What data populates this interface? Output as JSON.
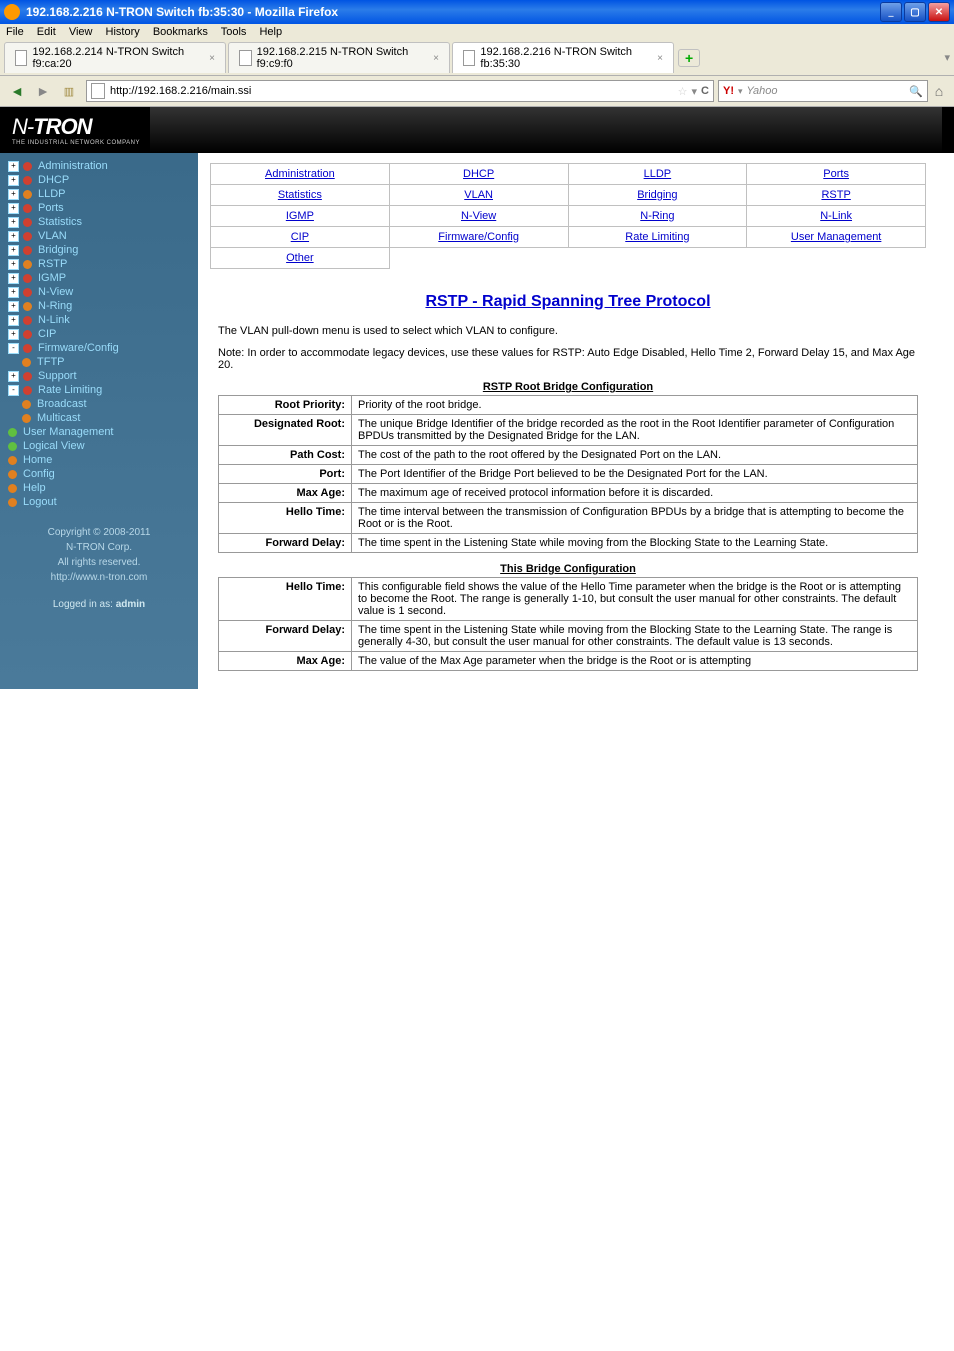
{
  "window": {
    "title": "192.168.2.216 N-TRON Switch fb:35:30 - Mozilla Firefox"
  },
  "menu": {
    "file": "File",
    "edit": "Edit",
    "view": "View",
    "history": "History",
    "bookmarks": "Bookmarks",
    "tools": "Tools",
    "help": "Help"
  },
  "tabs": [
    {
      "label": "192.168.2.214 N-TRON Switch f9:ca:20"
    },
    {
      "label": "192.168.2.215 N-TRON Switch f9:c9:f0"
    },
    {
      "label": "192.168.2.216 N-TRON Switch fb:35:30"
    }
  ],
  "url": "http://192.168.2.216/main.ssi",
  "search_placeholder": "Yahoo",
  "logo": {
    "brand": "N-TRON",
    "sub": "THE INDUSTRIAL NETWORK COMPANY"
  },
  "tree": {
    "admin": "Administration",
    "dhcp": "DHCP",
    "lldp": "LLDP",
    "ports": "Ports",
    "stats": "Statistics",
    "vlan": "VLAN",
    "bridging": "Bridging",
    "rstp": "RSTP",
    "igmp": "IGMP",
    "nview": "N-View",
    "nring": "N-Ring",
    "nlink": "N-Link",
    "cip": "CIP",
    "fw": "Firmware/Config",
    "tftp": "TFTP",
    "support": "Support",
    "rate": "Rate Limiting",
    "broadcast": "Broadcast",
    "multicast": "Multicast",
    "usermgmt": "User Management",
    "logical": "Logical View",
    "home": "Home",
    "config": "Config",
    "help": "Help",
    "logout": "Logout"
  },
  "footer": {
    "copyright": "Copyright © 2008-2011",
    "corp": "N-TRON Corp.",
    "rights": "All rights reserved.",
    "url": "http://www.n-tron.com",
    "logged_label": "Logged in as:",
    "user": "admin"
  },
  "links": {
    "administration": "Administration",
    "dhcp": "DHCP",
    "lldp": "LLDP",
    "ports": "Ports",
    "statistics": "Statistics",
    "vlan": "VLAN",
    "bridging": "Bridging",
    "rstp": "RSTP",
    "igmp": "IGMP",
    "nview": "N-View",
    "nring": "N-Ring",
    "nlink": "N-Link",
    "cip": "CIP",
    "fw": "Firmware/Config",
    "rate": "Rate Limiting",
    "usermgmt": "User Management",
    "other": "Other"
  },
  "page": {
    "title": "RSTP - Rapid Spanning Tree Protocol",
    "intro1": "The VLAN pull-down menu is used to select which VLAN to configure.",
    "intro2": "Note: In order to accommodate legacy devices, use these values for RSTP: Auto Edge Disabled, Hello Time 2, Forward Delay 15, and Max Age 20.",
    "root_title": "RSTP Root Bridge Configuration",
    "root": [
      {
        "k": "Root Priority:",
        "v": "Priority of the root bridge."
      },
      {
        "k": "Designated Root:",
        "v": "The unique Bridge Identifier of the bridge recorded as the root in the Root Identifier parameter of Configuration BPDUs transmitted by the Designated Bridge for the LAN."
      },
      {
        "k": "Path Cost:",
        "v": "The cost of the path to the root offered by the Designated Port on the LAN."
      },
      {
        "k": "Port:",
        "v": "The Port Identifier of the Bridge Port believed to be the Designated Port for the LAN."
      },
      {
        "k": "Max Age:",
        "v": "The maximum age of received protocol information before it is discarded."
      },
      {
        "k": "Hello Time:",
        "v": "The time interval between the transmission of Configuration BPDUs by a bridge that is attempting to become the Root or is the Root."
      },
      {
        "k": "Forward Delay:",
        "v": "The time spent in the Listening State while moving from the Blocking State to the Learning State."
      }
    ],
    "this_title": "This Bridge Configuration",
    "this": [
      {
        "k": "Hello Time:",
        "v": "This configurable field shows the value of the Hello Time parameter when the bridge is the Root or is attempting to become the Root. The range is generally 1-10, but consult the user manual for other constraints. The default value is 1 second."
      },
      {
        "k": "Forward Delay:",
        "v": "The time spent in the Listening State while moving from the Blocking State to the Learning State. The range is generally 4-30, but consult the user manual for other constraints. The default value is 13 seconds."
      },
      {
        "k": "Max Age:",
        "v": "The value of the Max Age parameter when the bridge is the Root or is attempting"
      }
    ]
  }
}
